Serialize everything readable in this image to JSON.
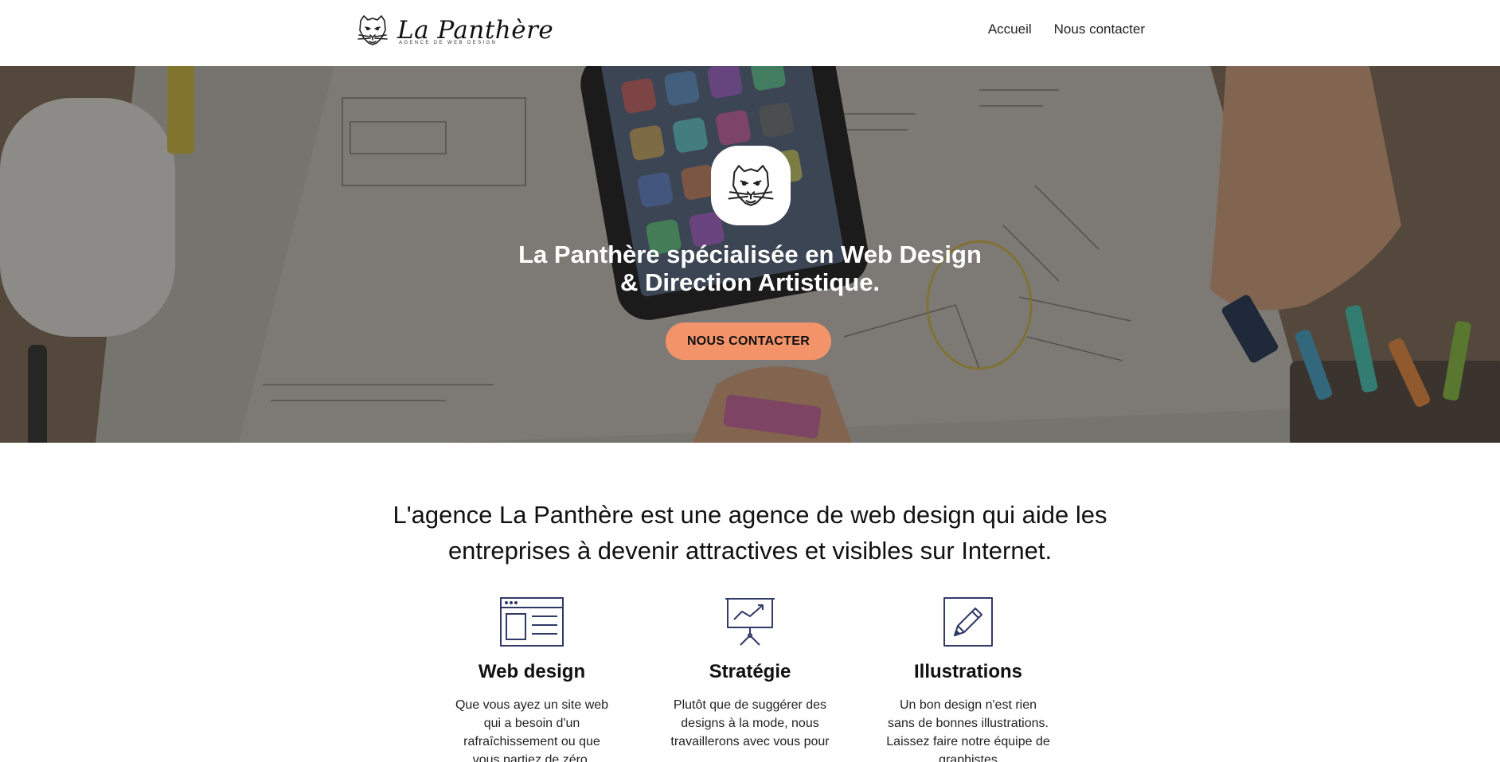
{
  "header": {
    "logo_name": "La Panthère",
    "logo_tagline": "AGENCE DE WEB DESIGN",
    "logo_icon": "panther-head-icon",
    "nav": [
      {
        "label": "Accueil"
      },
      {
        "label": "Nous contacter"
      }
    ]
  },
  "hero": {
    "badge_icon": "panther-head-icon",
    "title": "La Panthère spécialisée en Web Design & Direction Artistique.",
    "cta_label": "NOUS CONTACTER",
    "cta_color": "#f2936a"
  },
  "intro": {
    "text": "L'agence La Panthère est une agence de web design qui aide les entreprises à devenir attractives et visibles sur Internet."
  },
  "services": [
    {
      "icon": "browser-window-icon",
      "title": "Web design",
      "text": "Que vous ayez un site web qui a besoin d'un rafraîchissement ou que vous partiez de zéro,"
    },
    {
      "icon": "presentation-chart-icon",
      "title": "Stratégie",
      "text": "Plutôt que de suggérer des designs à la mode, nous travaillerons avec vous pour"
    },
    {
      "icon": "pencil-edit-icon",
      "title": "Illustrations",
      "text": "Un bon design n'est rien sans de bonnes illustrations. Laissez faire notre équipe de graphistes"
    }
  ],
  "colors": {
    "accent": "#f2936a",
    "icon_navy": "#2f3a66"
  }
}
